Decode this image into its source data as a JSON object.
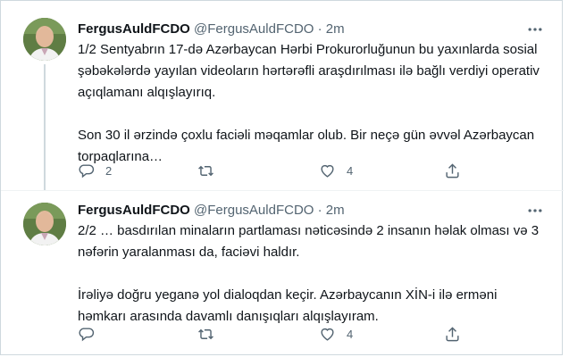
{
  "tweets": [
    {
      "name": "FergusAuldFCDO",
      "handle": "@FergusAuldFCDO",
      "dot": "·",
      "time": "2m",
      "paragraphs": [
        "1/2 Sentyabrın 17-də Azərbaycan Hərbi Prokurorluğunun bu yaxınlarda sosial şəbəkələrdə yayılan videoların hərtərəfli araşdırılması ilə bağlı verdiyi operativ açıqlamanı alqışlayırıq.",
        "Son 30 il ərzində çoxlu faciəli məqamlar olub. Bir neçə gün əvvəl Azərbaycan torpaqlarına…"
      ],
      "replies": "2",
      "retweets": "",
      "likes": "4"
    },
    {
      "name": "FergusAuldFCDO",
      "handle": "@FergusAuldFCDO",
      "dot": "·",
      "time": "2m",
      "paragraphs": [
        "2/2 … basdırılan minaların partlaması nəticəsində 2  insanın həlak olması və 3 nəfərin yaralanması da, faciəvi haldır.",
        "İrəliyə doğru yeganə yol dialoqdan keçir. Azərbaycanın XİN-i ilə erməni həmkarı arasında davamlı danışıqları alqışlayıram."
      ],
      "replies": "",
      "retweets": "",
      "likes": "4"
    }
  ],
  "icons": {
    "reply": "reply-icon",
    "retweet": "retweet-icon",
    "like": "heart-icon",
    "share": "share-icon",
    "more": "more-icon"
  },
  "colors": {
    "text": "#0f1419",
    "secondary": "#536471",
    "border": "#cfd9de",
    "thread_line": "#cfd9de"
  }
}
